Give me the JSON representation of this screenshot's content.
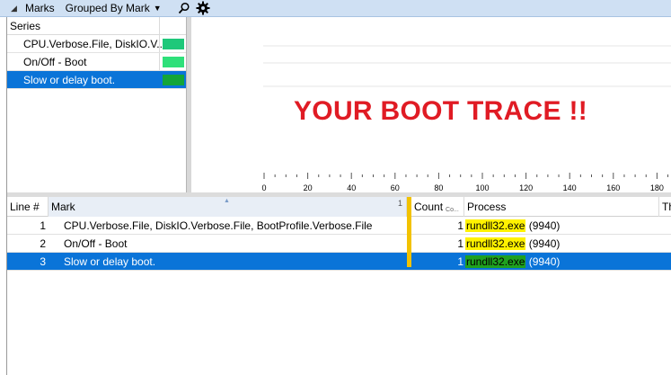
{
  "titlebar": {
    "title": "Marks",
    "grouping": "Grouped By Mark",
    "icons": [
      "collapse-triangle-icon",
      "search-icon",
      "gear-icon"
    ]
  },
  "series_panel": {
    "header": "Series",
    "items": [
      {
        "label": "CPU.Verbose.File, DiskIO.V...",
        "color": "#1ec87a",
        "selected": false
      },
      {
        "label": "On/Off - Boot",
        "color": "#2ee07a",
        "selected": false
      },
      {
        "label": "Slow or delay boot.",
        "color": "#13a538",
        "selected": true
      }
    ]
  },
  "graph": {
    "annotation": "YOUR BOOT TRACE !!",
    "annotation_color": "#e01b24",
    "axis_ticks": [
      "0",
      "20",
      "40",
      "60",
      "80",
      "100",
      "120",
      "140",
      "160",
      "180"
    ]
  },
  "table": {
    "columns": {
      "line": "Line #",
      "mark": "Mark",
      "mark_col_num": "1",
      "count": "Count",
      "count_sub": "Co...",
      "process": "Process",
      "extra": "Th"
    },
    "rows": [
      {
        "line": "1",
        "mark": "CPU.Verbose.File, DiskIO.Verbose.File, BootProfile.Verbose.File",
        "count": "1",
        "process_name": "rundll32.exe",
        "process_pid": "(9940)"
      },
      {
        "line": "2",
        "mark": "On/Off - Boot",
        "count": "1",
        "process_name": "rundll32.exe",
        "process_pid": "(9940)"
      },
      {
        "line": "3",
        "mark": "Slow or delay boot.",
        "count": "1",
        "process_name": "rundll32.exe",
        "process_pid": "(9940)"
      }
    ],
    "selected_row": 3,
    "highlight_color": "#fff200",
    "selection_color": "#0a74d8"
  }
}
